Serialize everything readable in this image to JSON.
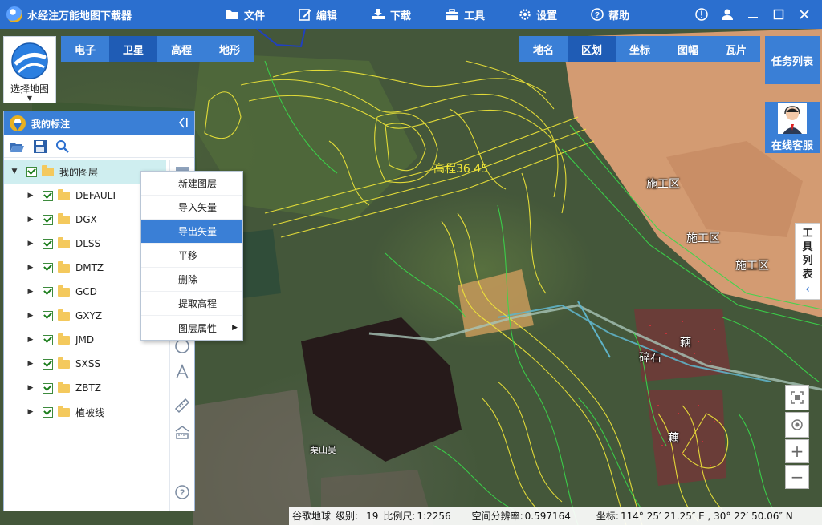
{
  "app": {
    "title": "水经注万能地图下载器"
  },
  "menu": [
    {
      "label": "文件",
      "icon": "folder-icon"
    },
    {
      "label": "编辑",
      "icon": "edit-icon"
    },
    {
      "label": "下载",
      "icon": "download-icon"
    },
    {
      "label": "工具",
      "icon": "toolbox-icon"
    },
    {
      "label": "设置",
      "icon": "gear-icon"
    },
    {
      "label": "帮助",
      "icon": "help-icon"
    }
  ],
  "select_map": {
    "label": "选择地图"
  },
  "map_tabs": [
    {
      "label": "电子",
      "active": false
    },
    {
      "label": "卫星",
      "active": true
    },
    {
      "label": "高程",
      "active": false
    },
    {
      "label": "地形",
      "active": false
    }
  ],
  "region_tabs": [
    {
      "label": "地名",
      "active": false
    },
    {
      "label": "区划",
      "active": true
    },
    {
      "label": "坐标",
      "active": false
    },
    {
      "label": "图幅",
      "active": false
    },
    {
      "label": "瓦片",
      "active": false
    }
  ],
  "task_list": {
    "label": "任务列表"
  },
  "online_service": {
    "label": "在线客服"
  },
  "tools_tab": {
    "chars": [
      "工",
      "具",
      "列",
      "表"
    ]
  },
  "panel": {
    "title": "我的标注",
    "root": "我的图层",
    "layers": [
      "DEFAULT",
      "DGX",
      "DLSS",
      "DMTZ",
      "GCD",
      "GXYZ",
      "JMD",
      "SXSS",
      "ZBTZ",
      "植被线"
    ]
  },
  "context_menu": [
    {
      "label": "新建图层",
      "highlighted": false,
      "submenu": false
    },
    {
      "label": "导入矢量",
      "highlighted": false,
      "submenu": false
    },
    {
      "label": "导出矢量",
      "highlighted": true,
      "submenu": false
    },
    {
      "label": "平移",
      "highlighted": false,
      "submenu": false
    },
    {
      "label": "删除",
      "highlighted": false,
      "submenu": false
    },
    {
      "label": "提取高程",
      "highlighted": false,
      "submenu": false
    },
    {
      "label": "图层属性",
      "highlighted": false,
      "submenu": true
    }
  ],
  "map_labels": {
    "elevation": "高程36.45",
    "construction1": "施工区",
    "construction2": "施工区",
    "construction3": "施工区",
    "lotus1": "藕",
    "lotus2": "藕",
    "gravel": "碎石",
    "village": "栗山吴"
  },
  "status": {
    "source": "谷歌地球",
    "level_label": "级别:",
    "level": "19",
    "scale_label": "比例尺:",
    "scale": "1:2256",
    "resolution_label": "空间分辨率:",
    "resolution": "0.597164",
    "coord_label": "坐标:",
    "coord": "114° 25′ 21.25″ E , 30° 22′ 50.06″ N"
  },
  "colors": {
    "title_bar": "#2b6fcf",
    "tab": "#3a7fd6",
    "tab_active": "#1f5cb5",
    "contour_yellow": "#f2e838",
    "contour_green": "#39d84a"
  }
}
